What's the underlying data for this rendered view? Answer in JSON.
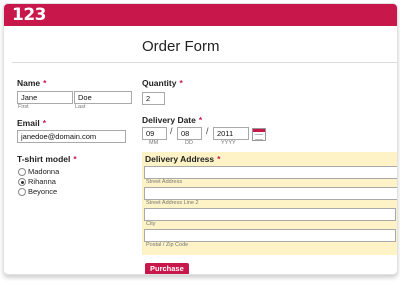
{
  "logo": "123",
  "form_title": "Order Form",
  "name": {
    "label": "Name",
    "required": "*",
    "first_value": "Jane",
    "first_sub": "First",
    "last_value": "Doe",
    "last_sub": "Last"
  },
  "email": {
    "label": "Email",
    "required": "*",
    "value": "janedoe@domain.com"
  },
  "tshirt": {
    "label": "T-shirt model",
    "required": "*",
    "options": [
      {
        "label": "Madonna",
        "selected": false
      },
      {
        "label": "Rihanna",
        "selected": true
      },
      {
        "label": "Beyonce",
        "selected": false
      }
    ]
  },
  "quantity": {
    "label": "Quantity",
    "required": "*",
    "value": "2"
  },
  "delivery_date": {
    "label": "Delivery Date",
    "required": "*",
    "month": "09",
    "day": "08",
    "year": "2011",
    "separator": "/",
    "month_sub": "MM",
    "day_sub": "DD",
    "year_sub": "YYYY",
    "picker_icon": "calendar-icon"
  },
  "delivery_address": {
    "label": "Delivery Address",
    "required": "*",
    "street_sub": "Street Address",
    "street2_sub": "Street Address Line 2",
    "city_sub": "City",
    "postal_sub": "Postal / Zip Code"
  },
  "submit": {
    "label": "Purchase"
  },
  "colors": {
    "accent": "#c8174a",
    "highlight": "#fdf3c6"
  }
}
